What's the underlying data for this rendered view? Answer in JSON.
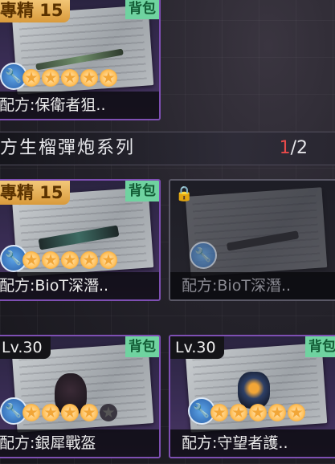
{
  "section_header": {
    "title": "方生榴彈炮系列",
    "page_current": "1",
    "page_sep": "/",
    "page_total": "2"
  },
  "cards": [
    {
      "tag": "專精 15",
      "badge": "背包",
      "name": "配方:保衛者狙..",
      "stars": 5,
      "stars_filled": 5
    },
    {
      "tag": "專精 15",
      "badge": "背包",
      "name": "配方:BioT深潛..",
      "stars": 5,
      "stars_filled": 5
    },
    {
      "lock": "🔒",
      "name": "配方:BioT深潛..",
      "stars": 0,
      "stars_filled": 0
    },
    {
      "tag": "Lv.30",
      "badge": "背包",
      "name": "配方:銀犀戰盔",
      "stars": 5,
      "stars_filled": 4
    },
    {
      "tag": "Lv.30",
      "badge": "背包",
      "name": "配方:守望者護..",
      "stars": 5,
      "stars_filled": 5
    }
  ],
  "icons": {
    "wrench": "🔧",
    "star": "★"
  },
  "colors": {
    "rare_border": "#7e4fb3",
    "badge_green": "#6fd3a0",
    "tag_gold": "#f3c879",
    "page_red": "#e84a4a"
  }
}
